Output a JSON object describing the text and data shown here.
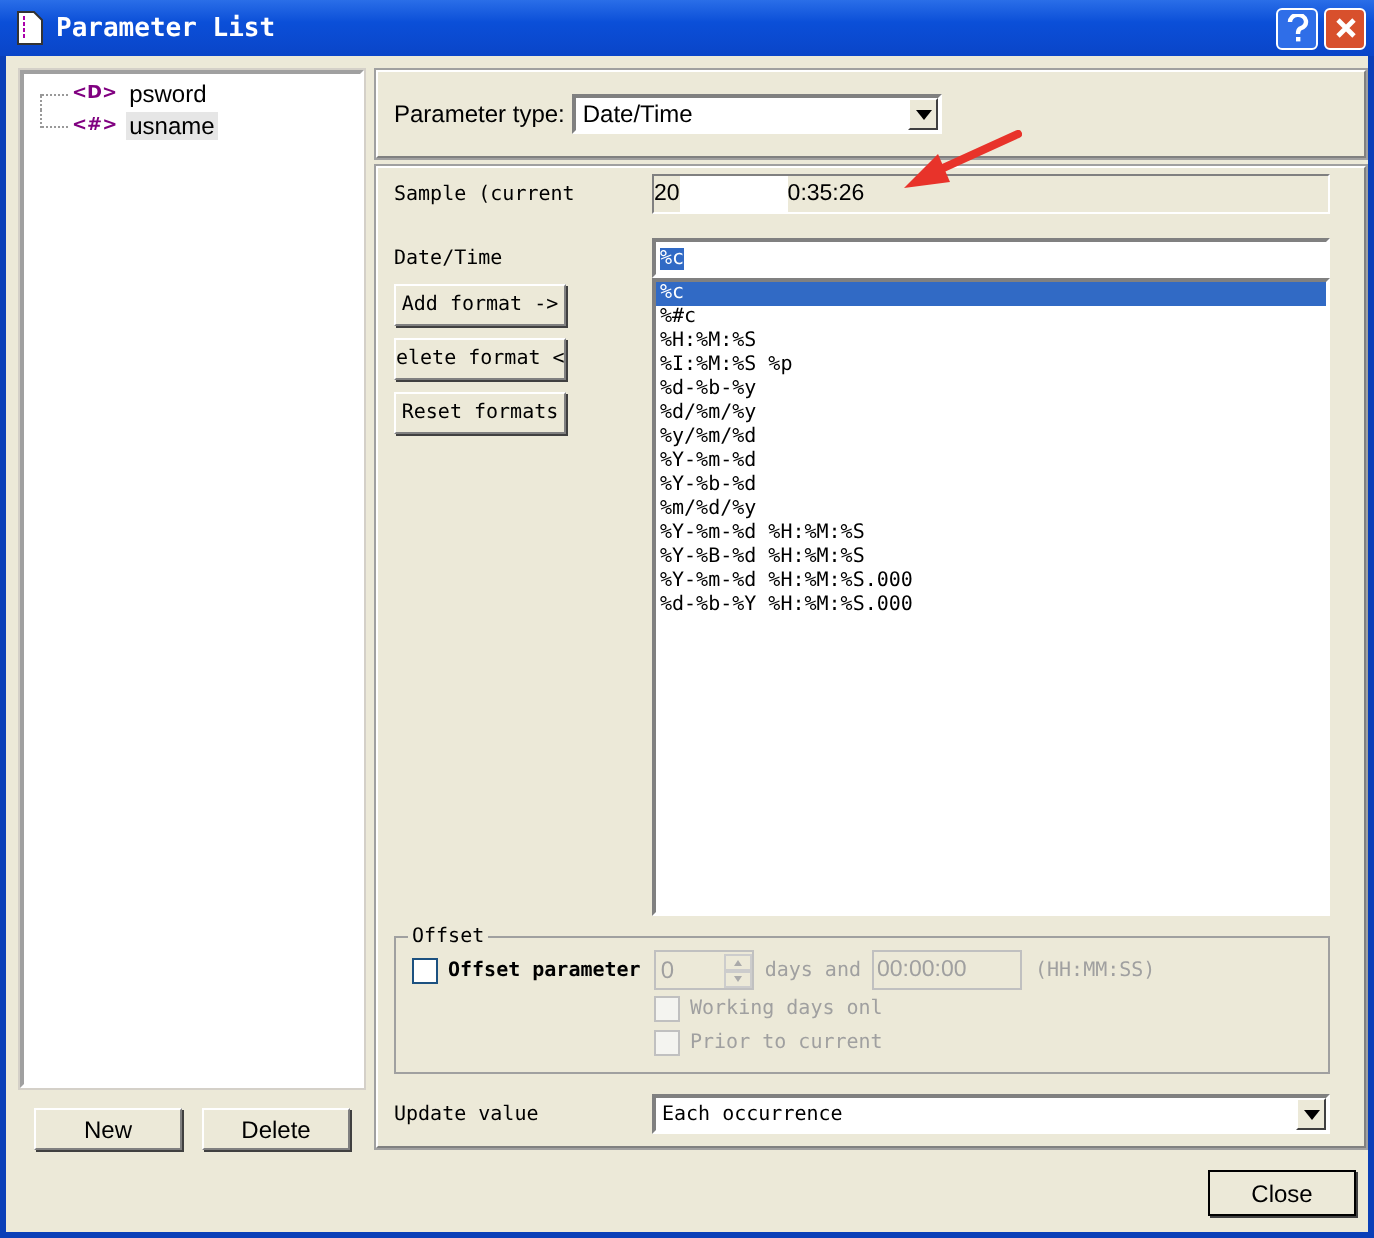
{
  "window": {
    "title": "Parameter List"
  },
  "tree": [
    {
      "tag": "<D>",
      "label": "psword",
      "selected": false
    },
    {
      "tag": "<#>",
      "label": "usname",
      "selected": true
    }
  ],
  "tree_buttons": [
    "New",
    "Delete"
  ],
  "parameter_type": {
    "label": "Parameter type:",
    "value": "Date/Time"
  },
  "sample": {
    "label": "Sample (current",
    "value_start": "20",
    "value_end": "0:35:26"
  },
  "date_time": {
    "label": "Date/Time",
    "value": "%c"
  },
  "format_buttons": [
    "Add format ->",
    "elete format <",
    "Reset formats"
  ],
  "formats": [
    {
      "text": "%c",
      "selected": true
    },
    {
      "text": "%#c",
      "selected": false
    },
    {
      "text": "%H:%M:%S",
      "selected": false
    },
    {
      "text": "%I:%M:%S %p",
      "selected": false
    },
    {
      "text": "%d-%b-%y",
      "selected": false
    },
    {
      "text": "%d/%m/%y",
      "selected": false
    },
    {
      "text": "%y/%m/%d",
      "selected": false
    },
    {
      "text": "%Y-%m-%d",
      "selected": false
    },
    {
      "text": "%Y-%b-%d",
      "selected": false
    },
    {
      "text": "%m/%d/%y",
      "selected": false
    },
    {
      "text": "%Y-%m-%d %H:%M:%S",
      "selected": false
    },
    {
      "text": "%Y-%B-%d %H:%M:%S",
      "selected": false
    },
    {
      "text": "%Y-%m-%d %H:%M:%S.000",
      "selected": false
    },
    {
      "text": "%d-%b-%Y %H:%M:%S.000",
      "selected": false
    }
  ],
  "offset": {
    "title": "Offset",
    "offset_parameter": {
      "label": "Offset parameter",
      "checked": false
    },
    "days": {
      "value": "0",
      "label": "days and",
      "disabled": true
    },
    "time": {
      "value": "00:00:00",
      "hint": "(HH:MM:SS)",
      "disabled": true
    },
    "options": [
      {
        "label": "Working days onl",
        "checked": false,
        "disabled": true
      },
      {
        "label": "Prior to current",
        "checked": false,
        "disabled": true
      }
    ]
  },
  "update": {
    "label": "Update value",
    "value": "Each occurrence"
  },
  "close_button": "Close"
}
